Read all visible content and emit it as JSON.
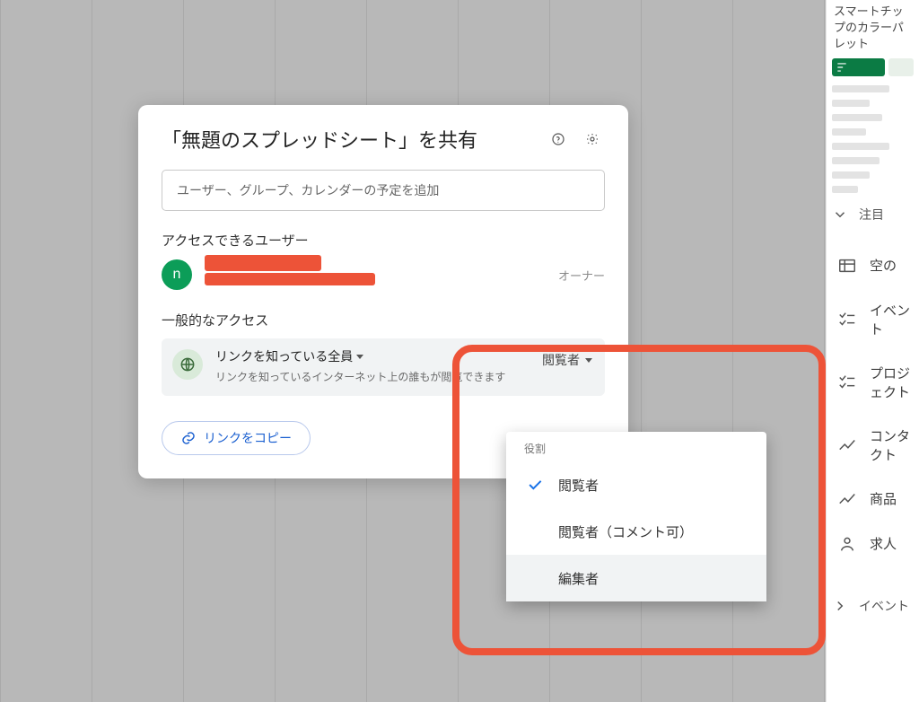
{
  "dialog": {
    "title": "「無題のスプレッドシート」を共有",
    "input_placeholder": "ユーザー、グループ、カレンダーの予定を追加",
    "access_label": "アクセスできるユーザー",
    "avatar_letter": "n",
    "owner_label": "オーナー",
    "general_label": "一般的なアクセス",
    "link_scope": "リンクを知っている全員",
    "link_scope_sub": "リンクを知っているインターネット上の誰もが閲覧できます",
    "current_role": "閲覧者",
    "copy_link": "リンクをコピー"
  },
  "popover": {
    "caption": "役割",
    "opt1": "閲覧者",
    "opt2": "閲覧者（コメント可）",
    "opt3": "編集者"
  },
  "side": {
    "title": "スマートチップのカラーパレット",
    "attention": "注目",
    "r_empty": "空の",
    "r_event": "イベント",
    "r_project": "プロジェクト",
    "r_contact": "コンタクト",
    "r_product": "商品",
    "r_job": "求人",
    "r_event2": "イベント"
  }
}
